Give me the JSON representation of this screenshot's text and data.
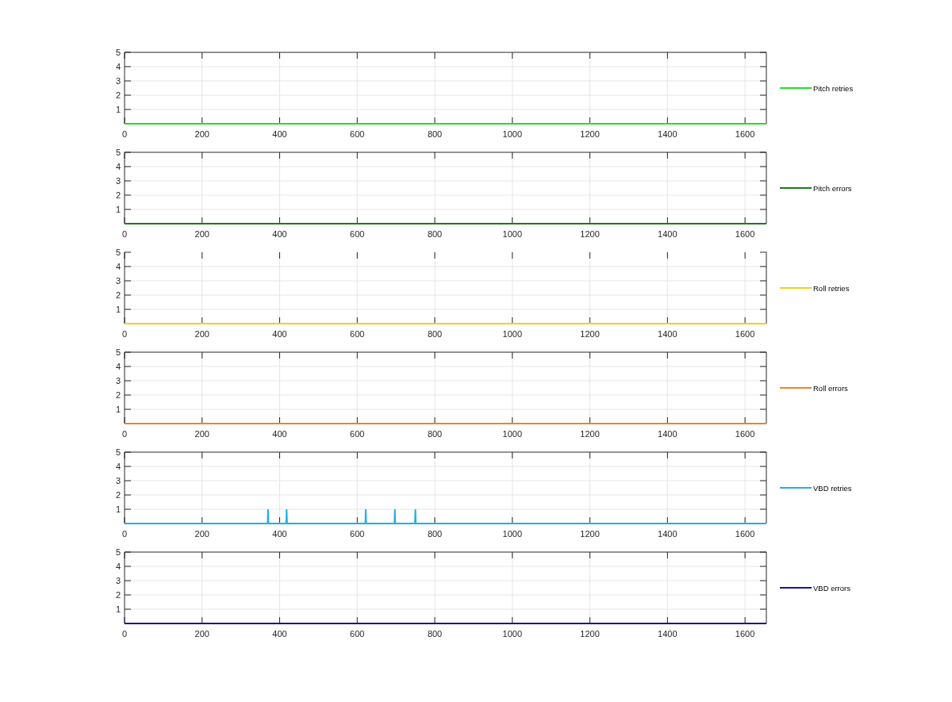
{
  "charts": [
    {
      "frame_top": true,
      "chart_data": {
        "type": "line",
        "grid": true,
        "x": [
          0,
          1655
        ],
        "xlim": [
          0,
          1655
        ],
        "ylim": [
          0,
          5
        ],
        "xticks": [
          0,
          200,
          400,
          600,
          800,
          1000,
          1200,
          1400,
          1600
        ],
        "yticks": [
          1,
          2,
          3,
          4,
          5
        ],
        "series": [
          {
            "name": "Pitch retries",
            "color": "#22e022",
            "values": [
              0,
              0
            ]
          }
        ]
      }
    },
    {
      "frame_top": true,
      "chart_data": {
        "type": "line",
        "grid": true,
        "x": [
          0,
          1655
        ],
        "xlim": [
          0,
          1655
        ],
        "ylim": [
          0,
          5
        ],
        "xticks": [
          0,
          200,
          400,
          600,
          800,
          1000,
          1200,
          1400,
          1600
        ],
        "yticks": [
          1,
          2,
          3,
          4,
          5
        ],
        "series": [
          {
            "name": "Pitch errors",
            "color": "#1b7a1b",
            "values": [
              0,
              0
            ]
          }
        ]
      }
    },
    {
      "frame_top": false,
      "chart_data": {
        "type": "line",
        "grid": true,
        "x": [
          0,
          1655
        ],
        "xlim": [
          0,
          1655
        ],
        "ylim": [
          0,
          5
        ],
        "xticks": [
          0,
          200,
          400,
          600,
          800,
          1000,
          1200,
          1400,
          1600
        ],
        "yticks": [
          1,
          2,
          3,
          4,
          5
        ],
        "series": [
          {
            "name": "Roll retries",
            "color": "#f2d210",
            "values": [
              0,
              0
            ]
          }
        ]
      }
    },
    {
      "frame_top": true,
      "chart_data": {
        "type": "line",
        "grid": true,
        "x": [
          0,
          1655
        ],
        "xlim": [
          0,
          1655
        ],
        "ylim": [
          0,
          5
        ],
        "xticks": [
          0,
          200,
          400,
          600,
          800,
          1000,
          1200,
          1400,
          1600
        ],
        "yticks": [
          1,
          2,
          3,
          4,
          5
        ],
        "series": [
          {
            "name": "Roll errors",
            "color": "#ee8422",
            "values": [
              0,
              0
            ]
          }
        ]
      }
    },
    {
      "frame_top": true,
      "chart_data": {
        "type": "line",
        "grid": true,
        "x": [
          0,
          369,
          370,
          371,
          417,
          418,
          419,
          621,
          622,
          623,
          696,
          697,
          698,
          749,
          750,
          751,
          1655
        ],
        "xlim": [
          0,
          1655
        ],
        "ylim": [
          0,
          5
        ],
        "xticks": [
          0,
          200,
          400,
          600,
          800,
          1000,
          1200,
          1400,
          1600
        ],
        "yticks": [
          1,
          2,
          3,
          4,
          5
        ],
        "series": [
          {
            "name": "VBD retries",
            "color": "#22b0e0",
            "values": [
              0,
              0,
              1,
              0,
              0,
              1,
              0,
              0,
              1,
              0,
              0,
              1,
              0,
              0,
              1,
              0,
              0
            ]
          }
        ]
      }
    },
    {
      "frame_top": true,
      "chart_data": {
        "type": "line",
        "grid": true,
        "x": [
          0,
          1655
        ],
        "xlim": [
          0,
          1655
        ],
        "ylim": [
          0,
          5
        ],
        "xticks": [
          0,
          200,
          400,
          600,
          800,
          1000,
          1200,
          1400,
          1600
        ],
        "yticks": [
          1,
          2,
          3,
          4,
          5
        ],
        "series": [
          {
            "name": "VBD errors",
            "color": "#1414a0",
            "values": [
              0,
              0
            ]
          }
        ]
      }
    }
  ]
}
